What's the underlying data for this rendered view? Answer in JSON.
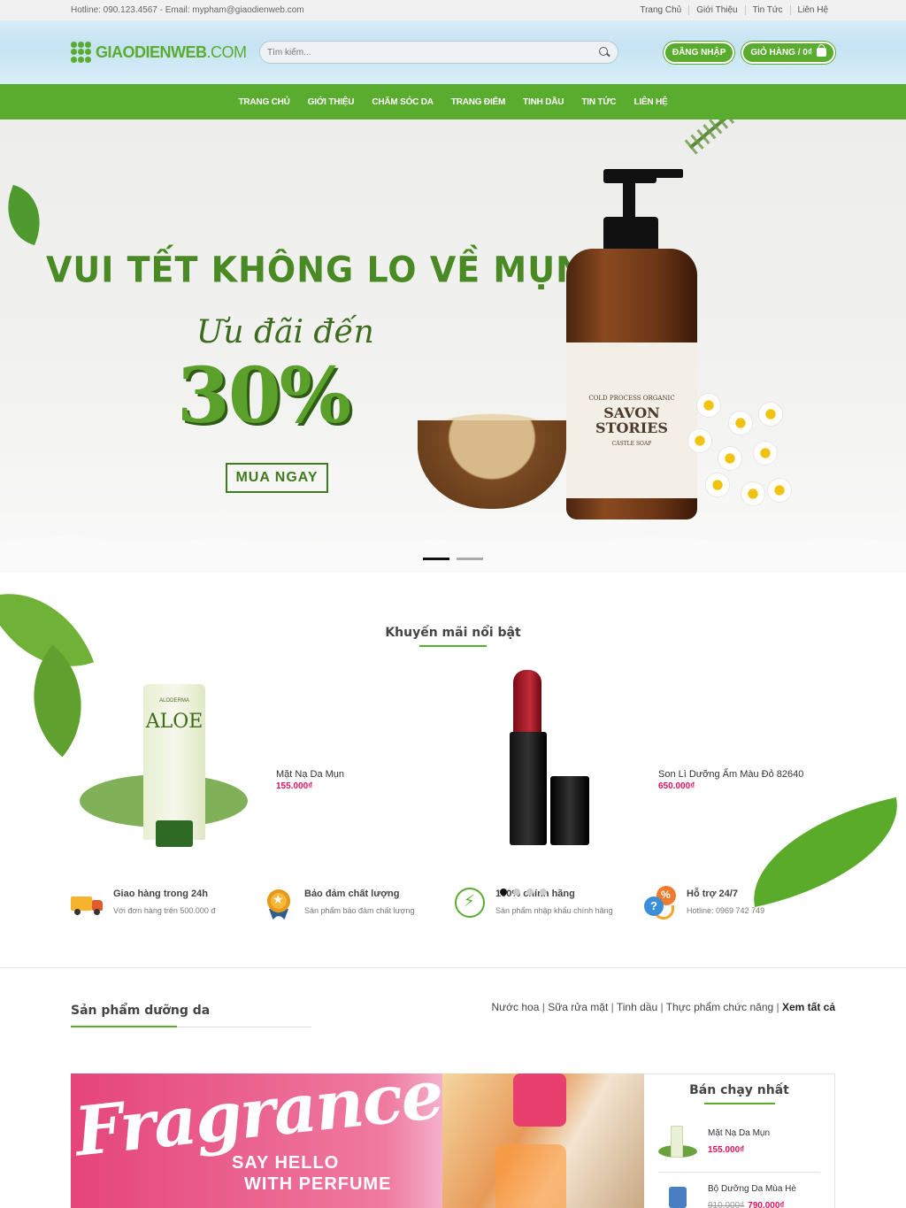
{
  "topbar": {
    "contact": "Hotline: 090.123.4567 - Email: mypham@giaodienweb.com",
    "links": [
      "Trang Chủ",
      "Giới Thiệu",
      "Tin Tức",
      "Liên Hệ"
    ]
  },
  "header": {
    "logo_bold": "GIAODIENWEB",
    "logo_thin": ".COM",
    "search_placeholder": "Tìm kiếm...",
    "login_label": "ĐĂNG NHẬP",
    "cart_label": "GIỎ HÀNG / 0₫"
  },
  "nav": [
    "TRANG CHỦ",
    "GIỚI THIỆU",
    "CHĂM SÓC DA",
    "TRANG ĐIỂM",
    "TINH DẦU",
    "TIN TỨC",
    "LIÊN HỆ"
  ],
  "hero": {
    "title": "VUI TẾT KHÔNG LO VỀ MỤN",
    "subtitle": "Ưu đãi đến",
    "percent": "30%",
    "cta": "MUA NGAY",
    "bottle_label_top": "COLD PROCESS ORGANIC",
    "bottle_label_main": "SAVON STORIES",
    "bottle_label_sub": "CASTLE SOAP",
    "slides": 2,
    "active_slide": 1
  },
  "promotions": {
    "title": "Khuyến mãi nổi bật",
    "items": [
      {
        "name": "Mặt Nạ Da Mụn",
        "price": "155.000₫",
        "tube_brand": "ALODERMA",
        "tube_name": "ALOE"
      },
      {
        "name": "Son Lì Dưỡng Ẩm Màu Đỏ 82640",
        "price": "650.000₫"
      }
    ],
    "pages": 4,
    "active_page": 1
  },
  "features": [
    {
      "icon": "truck-icon",
      "title": "Giao hàng trong 24h",
      "desc": "Với đơn hàng trên 500.000 đ"
    },
    {
      "icon": "medal-icon",
      "title": "Bảo đảm chất lượng",
      "desc": "Sản phẩm bảo đảm chất lượng"
    },
    {
      "icon": "lightning-icon",
      "title": "100% chính hãng",
      "desc": "Sản phẩm nhập khẩu chính hãng"
    },
    {
      "icon": "support-icon",
      "title": "Hỗ trợ 24/7",
      "desc": "Hotline: 0969 742 749"
    }
  ],
  "skin_section": {
    "title": "Sản phẩm dưỡng da",
    "links": [
      "Nước hoa",
      "Sữa rửa mặt",
      "Tinh dầu",
      "Thực phẩm chức năng"
    ],
    "view_all": "Xem tất cả",
    "banner": {
      "script": "Fragrance",
      "line1": "SAY HELLO",
      "line2": "WITH PERFUME"
    }
  },
  "best_sellers": {
    "title": "Bán chạy nhất",
    "items": [
      {
        "name": "Mặt Nạ Da Mụn",
        "price": "155.000₫",
        "old_price": ""
      },
      {
        "name": "Bộ Dưỡng Da Mùa Hè",
        "price": "790.000₫",
        "old_price": "910.000₫"
      }
    ]
  },
  "colors": {
    "brand_green": "#5aac2f",
    "price_pink": "#e0125a"
  }
}
